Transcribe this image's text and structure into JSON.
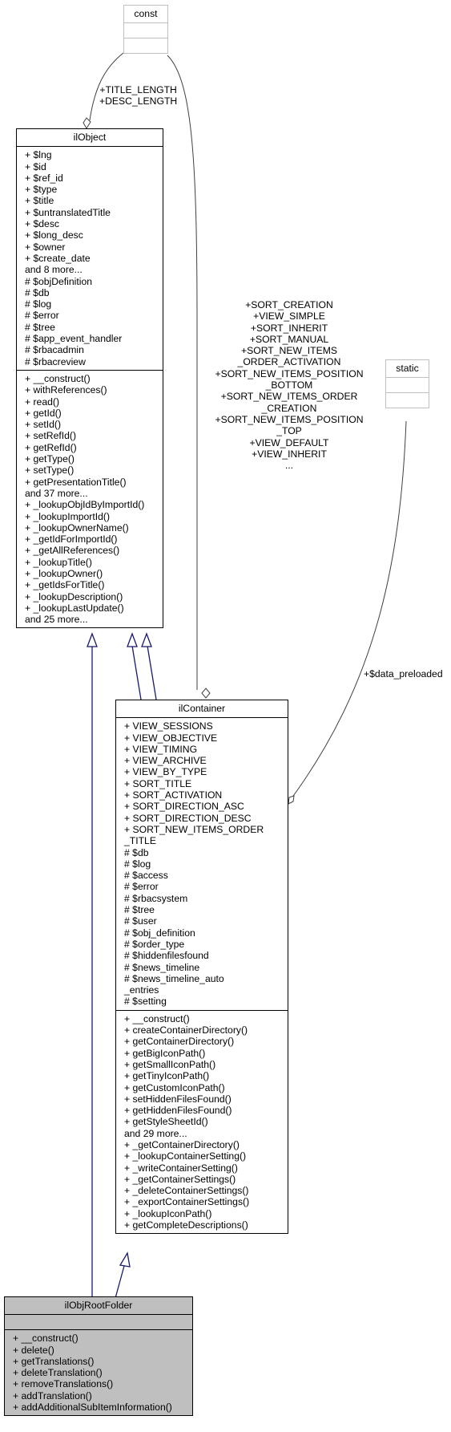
{
  "classes": {
    "const": {
      "name": "const"
    },
    "static": {
      "name": "static"
    },
    "ilObject": {
      "name": "ilObject",
      "attributes": [
        "+ $lng",
        "+ $id",
        "+ $ref_id",
        "+ $type",
        "+ $title",
        "+ $untranslatedTitle",
        "+ $desc",
        "+ $long_desc",
        "+ $owner",
        "+ $create_date",
        "and 8 more...",
        "# $objDefinition",
        "# $db",
        "# $log",
        "# $error",
        "# $tree",
        "# $app_event_handler",
        "# $rbacadmin",
        "# $rbacreview"
      ],
      "methods": [
        "+ __construct()",
        "+ withReferences()",
        "+ read()",
        "+ getId()",
        "+ setId()",
        "+ setRefId()",
        "+ getRefId()",
        "+ getType()",
        "+ setType()",
        "+ getPresentationTitle()",
        "and 37 more...",
        "+ _lookupObjIdByImportId()",
        "+ _lookupImportId()",
        "+ _lookupOwnerName()",
        "+ _getIdForImportId()",
        "+ _getAllReferences()",
        "+ _lookupTitle()",
        "+ _lookupOwner()",
        "+ _getIdsForTitle()",
        "+ _lookupDescription()",
        "+ _lookupLastUpdate()",
        "and 25 more..."
      ]
    },
    "ilContainer": {
      "name": "ilContainer",
      "attributes": [
        "+ VIEW_SESSIONS",
        "+ VIEW_OBJECTIVE",
        "+ VIEW_TIMING",
        "+ VIEW_ARCHIVE",
        "+ VIEW_BY_TYPE",
        "+ SORT_TITLE",
        "+ SORT_ACTIVATION",
        "+ SORT_DIRECTION_ASC",
        "+ SORT_DIRECTION_DESC",
        "+ SORT_NEW_ITEMS_ORDER",
        "_TITLE",
        "# $db",
        "# $log",
        "# $access",
        "# $error",
        "# $rbacsystem",
        "# $tree",
        "# $user",
        "# $obj_definition",
        "# $order_type",
        "# $hiddenfilesfound",
        "# $news_timeline",
        "# $news_timeline_auto",
        "_entries",
        "# $setting"
      ],
      "methods": [
        "+ __construct()",
        "+ createContainerDirectory()",
        "+ getContainerDirectory()",
        "+ getBigIconPath()",
        "+ getSmallIconPath()",
        "+ getTinyIconPath()",
        "+ getCustomIconPath()",
        "+ setHiddenFilesFound()",
        "+ getHiddenFilesFound()",
        "+ getStyleSheetId()",
        "and 29 more...",
        "+ _getContainerDirectory()",
        "+ _lookupContainerSetting()",
        "+ _writeContainerSetting()",
        "+ _getContainerSettings()",
        "+ _deleteContainerSettings()",
        "+ _exportContainerSettings()",
        "+ _lookupIconPath()",
        "+ getCompleteDescriptions()"
      ]
    },
    "ilObjRootFolder": {
      "name": "ilObjRootFolder",
      "attributes": [],
      "methods": [
        "+ __construct()",
        "+ delete()",
        "+ getTranslations()",
        "+ deleteTranslation()",
        "+ removeTranslations()",
        "+ addTranslation()",
        "+ addAdditionalSubItemInformation()"
      ]
    }
  },
  "edge_labels": {
    "const_to_ilObject": [
      "+TITLE_LENGTH",
      "+DESC_LENGTH"
    ],
    "const_to_ilContainer": [
      "+SORT_CREATION",
      "+VIEW_SIMPLE",
      "+SORT_INHERIT",
      "+SORT_MANUAL",
      "+SORT_NEW_ITEMS",
      "_ORDER_ACTIVATION",
      "+SORT_NEW_ITEMS_POSITION",
      "_BOTTOM",
      "+SORT_NEW_ITEMS_ORDER",
      "_CREATION",
      "+SORT_NEW_ITEMS_POSITION",
      "_TOP",
      "+VIEW_DEFAULT",
      "+VIEW_INHERIT",
      "..."
    ],
    "static_to_ilContainer": [
      "+$data_preloaded"
    ]
  },
  "colors": {
    "inheritance": "#191970",
    "association": "#404040",
    "ghost_border": "#bfbfbf",
    "highlight_fill": "#bfbfbf"
  }
}
